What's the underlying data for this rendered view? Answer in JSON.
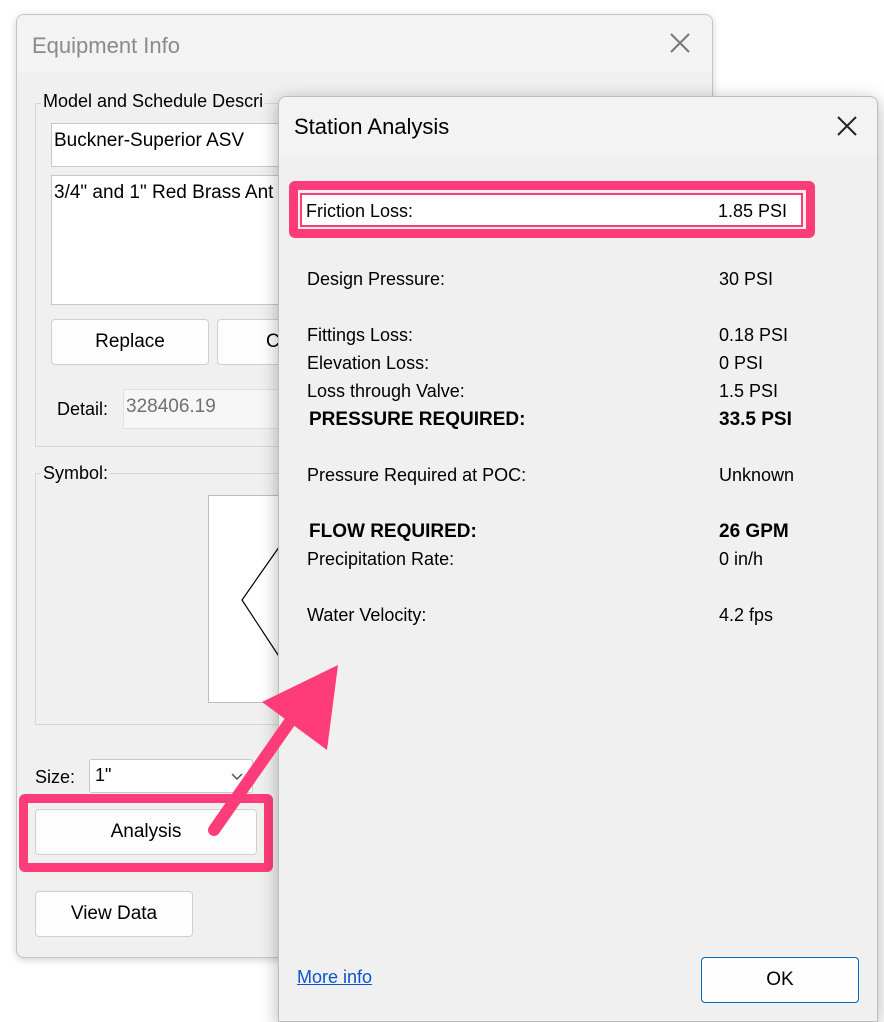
{
  "equipment_info": {
    "title": "Equipment Info",
    "group_model_label": "Model and Schedule Descri",
    "model_name": "Buckner-Superior ASV",
    "description": "3/4\" and 1\" Red Brass Ant",
    "replace_label": "Replace",
    "second_button_partial": "C",
    "detail_label": "Detail:",
    "detail_value": "328406.19",
    "symbol_label": "Symbol:",
    "size_label": "Size:",
    "size_value": "1\"",
    "analysis_label": "Analysis",
    "view_data_label": "View Data"
  },
  "station_analysis": {
    "title": "Station Analysis",
    "rows": [
      {
        "label": "Design Pressure:",
        "value": "30 PSI"
      },
      {
        "label": "Friction Loss:",
        "value": "1.85 PSI"
      },
      {
        "label": "Fittings Loss:",
        "value": "0.18 PSI"
      },
      {
        "label": "Elevation Loss:",
        "value": "0 PSI"
      },
      {
        "label": "Loss through Valve:",
        "value": "1.5 PSI"
      },
      {
        "label": "PRESSURE REQUIRED:",
        "value": "33.5 PSI"
      },
      {
        "label": "Pressure Required at POC:",
        "value": "Unknown"
      },
      {
        "label": "FLOW REQUIRED:",
        "value": "26 GPM"
      },
      {
        "label": "Precipitation Rate:",
        "value": "0 in/h"
      },
      {
        "label": "Water Velocity:",
        "value": "4.2 fps"
      }
    ],
    "more_info_label": "More info",
    "ok_label": "OK"
  },
  "colors": {
    "highlight": "#ff3c7a",
    "link": "#0b55c7",
    "dialog_bg": "#f0f0f0"
  }
}
